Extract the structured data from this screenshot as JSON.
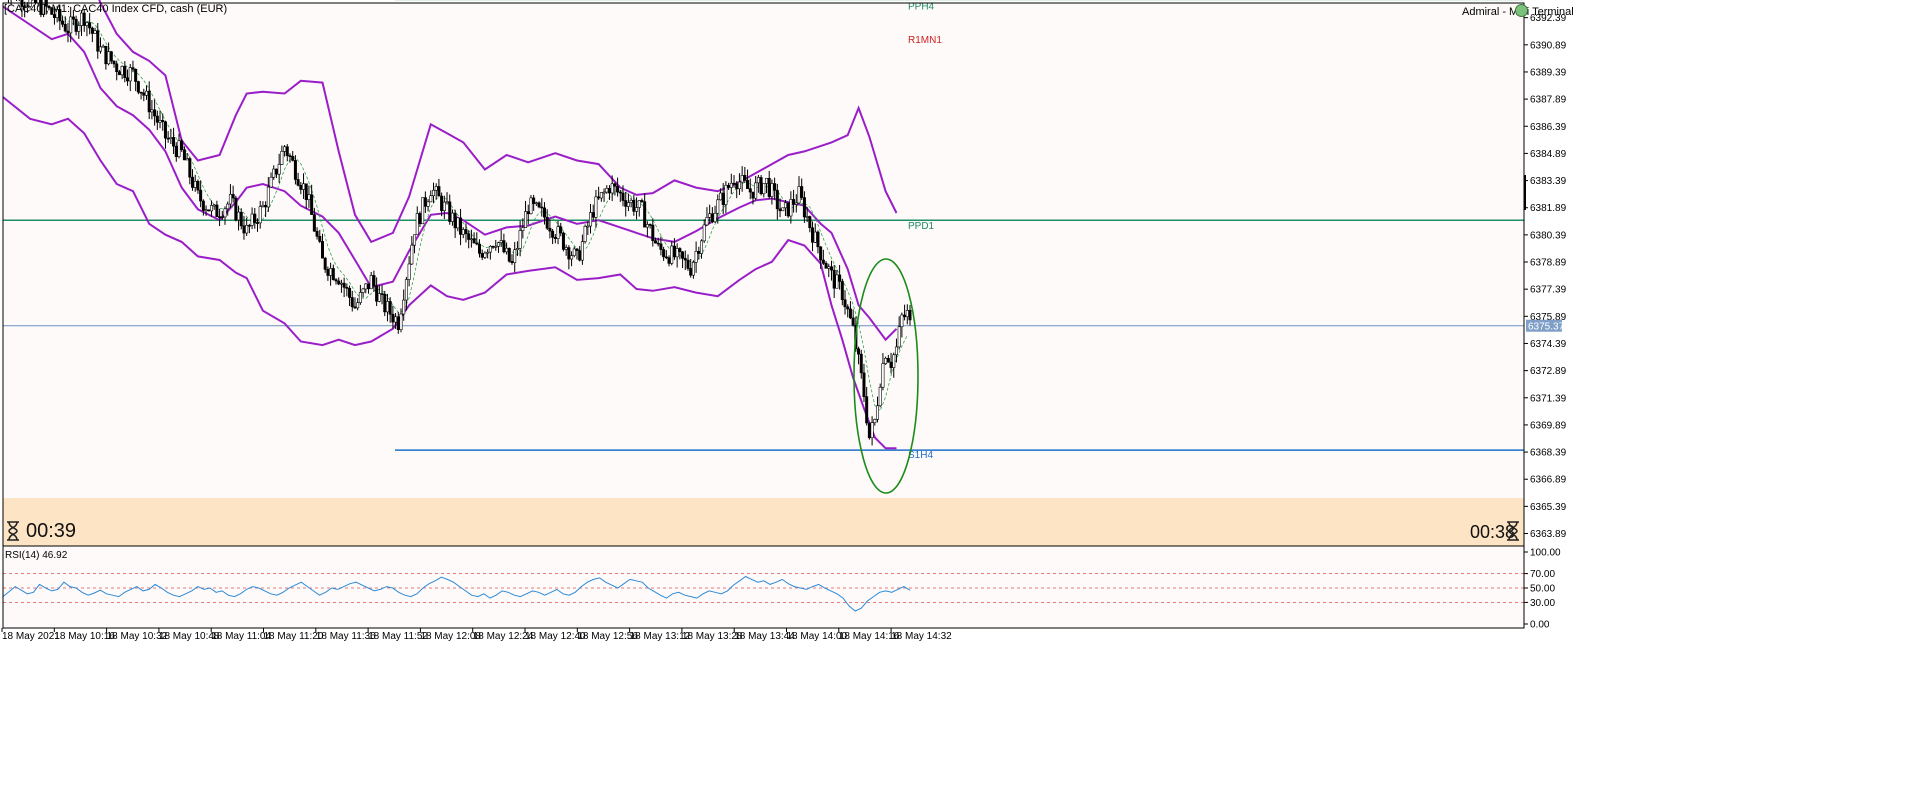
{
  "header": {
    "symbol_info": "[CAC40], M1:  CAC40 Index CFD, cash (EUR)",
    "terminal_name": "Admiral - Mini Terminal"
  },
  "timers": {
    "left": "00:39",
    "right": "00:38"
  },
  "colors": {
    "background": "#fffafa",
    "bands": "#9a1ec8",
    "candle_up": "#ffffff",
    "candle_down": "#000000",
    "pivot_line": "#1e8c64",
    "support_line": "#1e6fc8",
    "current_price_line": "#6a8fc0",
    "ellipse": "#1a8c1a",
    "rsi_line": "#2a8ad8",
    "timer_panel": "#fde4c4"
  },
  "chart_data": [
    {
      "type": "candlestick",
      "title": "[CAC40], M1:  CAC40 Index CFD, cash (EUR)",
      "price_ticks": [
        "6392.39",
        "6390.89",
        "6389.39",
        "6387.89",
        "6386.39",
        "6384.89",
        "6383.39",
        "6381.89",
        "6380.39",
        "6378.89",
        "6377.39",
        "6375.89",
        "6374.39",
        "6372.89",
        "6371.39",
        "6369.89",
        "6368.39",
        "6366.89",
        "6365.39",
        "6363.89"
      ],
      "ylim": [
        6363.2,
        6393.2
      ],
      "current_price": {
        "label": "6375.37",
        "value": 6375.37
      },
      "time_labels": [
        "18 May 2021",
        "18 May 10:16",
        "18 May 10:32",
        "18 May 10:48",
        "18 May 11:04",
        "18 May 11:20",
        "18 May 11:36",
        "18 May 11:52",
        "18 May 12:08",
        "18 May 12:24",
        "18 May 12:40",
        "18 May 12:56",
        "18 May 13:12",
        "18 May 13:28",
        "18 May 13:44",
        "18 May 14:00",
        "18 May 14:16",
        "18 May 14:32"
      ],
      "levels": [
        {
          "label": "PPH4",
          "value": 6393.4,
          "color": "#1e8c64"
        },
        {
          "label": "R1MN1",
          "value": 6391.5,
          "color": "#d02020",
          "line": false
        },
        {
          "label": "PPD1",
          "value": 6381.2,
          "color": "#1e8c64"
        },
        {
          "label": "S1H4",
          "value": 6368.5,
          "color": "#1e6fc8"
        }
      ],
      "close_path": [
        [
          0,
          6394.2
        ],
        [
          8,
          6393.4
        ],
        [
          16,
          6392.9
        ],
        [
          24,
          6391.8
        ],
        [
          30,
          6392.5
        ],
        [
          36,
          6390.6
        ],
        [
          42,
          6389.7
        ],
        [
          48,
          6389.3
        ],
        [
          54,
          6387.6
        ],
        [
          60,
          6385.8
        ],
        [
          66,
          6384.9
        ],
        [
          72,
          6382.5
        ],
        [
          78,
          6381.6
        ],
        [
          84,
          6382.2
        ],
        [
          90,
          6380.6
        ],
        [
          96,
          6381.9
        ],
        [
          104,
          6385.3
        ],
        [
          112,
          6382.7
        ],
        [
          118,
          6378.9
        ],
        [
          124,
          6378.1
        ],
        [
          130,
          6376.4
        ],
        [
          136,
          6377.9
        ],
        [
          140,
          6376.6
        ],
        [
          146,
          6375.6
        ],
        [
          152,
          6380.8
        ],
        [
          158,
          6383.0
        ],
        [
          164,
          6381.7
        ],
        [
          170,
          6380.4
        ],
        [
          176,
          6379.4
        ],
        [
          182,
          6380.2
        ],
        [
          188,
          6378.7
        ],
        [
          194,
          6382.0
        ],
        [
          200,
          6381.4
        ],
        [
          206,
          6380.2
        ],
        [
          212,
          6379.0
        ],
        [
          218,
          6381.8
        ],
        [
          224,
          6383.1
        ],
        [
          230,
          6382.4
        ],
        [
          236,
          6381.7
        ],
        [
          242,
          6379.6
        ],
        [
          248,
          6379.2
        ],
        [
          254,
          6378.6
        ],
        [
          260,
          6381.2
        ],
        [
          266,
          6382.5
        ],
        [
          270,
          6383.6
        ],
        [
          276,
          6382.8
        ],
        [
          282,
          6383.3
        ],
        [
          288,
          6381.5
        ],
        [
          294,
          6382.6
        ],
        [
          300,
          6380.1
        ],
        [
          306,
          6378.1
        ],
        [
          310,
          6377.2
        ],
        [
          314,
          6375.1
        ],
        [
          318,
          6371.6
        ],
        [
          320,
          6369.2
        ],
        [
          322,
          6370.1
        ],
        [
          324,
          6372.5
        ],
        [
          326,
          6374.0
        ],
        [
          328,
          6373.4
        ],
        [
          330,
          6374.1
        ],
        [
          332,
          6375.8
        ],
        [
          334,
          6376.0
        ],
        [
          335,
          6375.4
        ]
      ],
      "upper_band_path": [
        [
          0,
          6399.0
        ],
        [
          10,
          6397.5
        ],
        [
          18,
          6396.0
        ],
        [
          24,
          6396.5
        ],
        [
          30,
          6395.5
        ],
        [
          36,
          6393.2
        ],
        [
          42,
          6391.5
        ],
        [
          48,
          6390.5
        ],
        [
          54,
          6390.0
        ],
        [
          60,
          6389.2
        ],
        [
          66,
          6385.6
        ],
        [
          72,
          6384.5
        ],
        [
          80,
          6384.8
        ],
        [
          86,
          6387.0
        ],
        [
          90,
          6388.2
        ],
        [
          96,
          6388.3
        ],
        [
          104,
          6388.2
        ],
        [
          110,
          6388.9
        ],
        [
          118,
          6388.8
        ],
        [
          124,
          6385.0
        ],
        [
          130,
          6381.5
        ],
        [
          136,
          6380.0
        ],
        [
          144,
          6380.5
        ],
        [
          150,
          6382.5
        ],
        [
          158,
          6386.5
        ],
        [
          164,
          6386.0
        ],
        [
          170,
          6385.5
        ],
        [
          178,
          6384.0
        ],
        [
          186,
          6384.8
        ],
        [
          194,
          6384.4
        ],
        [
          204,
          6384.9
        ],
        [
          212,
          6384.5
        ],
        [
          220,
          6384.3
        ],
        [
          228,
          6383.0
        ],
        [
          234,
          6382.6
        ],
        [
          240,
          6382.7
        ],
        [
          248,
          6383.4
        ],
        [
          256,
          6383.0
        ],
        [
          264,
          6382.8
        ],
        [
          272,
          6383.3
        ],
        [
          278,
          6383.8
        ],
        [
          284,
          6384.3
        ],
        [
          290,
          6384.8
        ],
        [
          296,
          6385.0
        ],
        [
          306,
          6385.5
        ],
        [
          312,
          6385.9
        ],
        [
          316,
          6387.4
        ],
        [
          320,
          6385.8
        ],
        [
          326,
          6382.8
        ],
        [
          330,
          6381.6
        ]
      ],
      "middle_band_path": [
        [
          0,
          6393.0
        ],
        [
          10,
          6392.0
        ],
        [
          18,
          6391.2
        ],
        [
          24,
          6391.5
        ],
        [
          30,
          6390.5
        ],
        [
          36,
          6388.5
        ],
        [
          42,
          6387.5
        ],
        [
          48,
          6387.0
        ],
        [
          54,
          6386.2
        ],
        [
          60,
          6385.0
        ],
        [
          66,
          6383.0
        ],
        [
          72,
          6381.8
        ],
        [
          80,
          6381.2
        ],
        [
          86,
          6382.2
        ],
        [
          90,
          6383.0
        ],
        [
          96,
          6383.2
        ],
        [
          104,
          6382.8
        ],
        [
          110,
          6382.0
        ],
        [
          118,
          6381.4
        ],
        [
          124,
          6380.5
        ],
        [
          130,
          6379.0
        ],
        [
          136,
          6377.5
        ],
        [
          144,
          6377.8
        ],
        [
          150,
          6379.5
        ],
        [
          158,
          6381.5
        ],
        [
          164,
          6381.6
        ],
        [
          170,
          6381.2
        ],
        [
          178,
          6380.4
        ],
        [
          186,
          6380.8
        ],
        [
          194,
          6380.9
        ],
        [
          204,
          6381.4
        ],
        [
          212,
          6381.0
        ],
        [
          220,
          6381.2
        ],
        [
          228,
          6380.8
        ],
        [
          234,
          6380.5
        ],
        [
          240,
          6380.2
        ],
        [
          248,
          6380.0
        ],
        [
          256,
          6380.6
        ],
        [
          264,
          6381.3
        ],
        [
          272,
          6381.9
        ],
        [
          278,
          6382.3
        ],
        [
          284,
          6382.4
        ],
        [
          290,
          6382.2
        ],
        [
          296,
          6382.0
        ],
        [
          302,
          6381.0
        ],
        [
          306,
          6380.5
        ],
        [
          312,
          6378.5
        ],
        [
          316,
          6376.5
        ],
        [
          320,
          6375.8
        ],
        [
          326,
          6374.6
        ],
        [
          330,
          6375.2
        ]
      ],
      "lower_band_path": [
        [
          0,
          6388.0
        ],
        [
          10,
          6386.8
        ],
        [
          18,
          6386.5
        ],
        [
          24,
          6386.8
        ],
        [
          30,
          6386.0
        ],
        [
          36,
          6384.5
        ],
        [
          42,
          6383.2
        ],
        [
          48,
          6382.8
        ],
        [
          54,
          6381.0
        ],
        [
          60,
          6380.4
        ],
        [
          66,
          6380.0
        ],
        [
          72,
          6379.2
        ],
        [
          80,
          6379.0
        ],
        [
          86,
          6378.3
        ],
        [
          90,
          6378.0
        ],
        [
          96,
          6376.2
        ],
        [
          104,
          6375.5
        ],
        [
          110,
          6374.5
        ],
        [
          118,
          6374.3
        ],
        [
          124,
          6374.6
        ],
        [
          130,
          6374.3
        ],
        [
          136,
          6374.5
        ],
        [
          144,
          6375.2
        ],
        [
          150,
          6376.5
        ],
        [
          158,
          6377.6
        ],
        [
          164,
          6377.0
        ],
        [
          170,
          6376.8
        ],
        [
          178,
          6377.2
        ],
        [
          186,
          6378.2
        ],
        [
          194,
          6378.4
        ],
        [
          204,
          6378.6
        ],
        [
          212,
          6377.9
        ],
        [
          220,
          6378.0
        ],
        [
          228,
          6378.2
        ],
        [
          234,
          6377.4
        ],
        [
          240,
          6377.3
        ],
        [
          248,
          6377.5
        ],
        [
          256,
          6377.2
        ],
        [
          264,
          6377.0
        ],
        [
          272,
          6377.9
        ],
        [
          278,
          6378.5
        ],
        [
          284,
          6378.9
        ],
        [
          290,
          6380.1
        ],
        [
          296,
          6379.8
        ],
        [
          302,
          6378.8
        ],
        [
          306,
          6376.5
        ],
        [
          310,
          6374.6
        ],
        [
          314,
          6372.5
        ],
        [
          318,
          6370.8
        ],
        [
          322,
          6369.2
        ],
        [
          326,
          6368.6
        ],
        [
          330,
          6368.6
        ]
      ],
      "annotation": {
        "shape": "ellipse",
        "note": "green ellipse around the dip near S1H4"
      }
    },
    {
      "type": "line",
      "title": "RSI(14) 46.92",
      "label": "RSI(14) 46.92",
      "ticks": [
        "100.00",
        "70.00",
        "50.00",
        "30.00",
        "0.00"
      ],
      "ylim": [
        0,
        100
      ],
      "reference_lines": [
        70,
        50,
        30
      ],
      "values": [
        38,
        45,
        52,
        47,
        42,
        44,
        55,
        50,
        46,
        48,
        58,
        52,
        50,
        44,
        40,
        43,
        47,
        42,
        40,
        38,
        44,
        48,
        52,
        46,
        48,
        55,
        50,
        44,
        40,
        38,
        42,
        46,
        52,
        48,
        50,
        44,
        46,
        40,
        38,
        42,
        48,
        52,
        50,
        46,
        42,
        40,
        44,
        50,
        54,
        58,
        52,
        46,
        40,
        44,
        50,
        48,
        52,
        56,
        58,
        54,
        50,
        46,
        48,
        52,
        50,
        44,
        40,
        38,
        42,
        50,
        56,
        60,
        65,
        62,
        58,
        52,
        46,
        40,
        38,
        42,
        36,
        40,
        46,
        44,
        40,
        38,
        42,
        46,
        44,
        40,
        44,
        48,
        42,
        40,
        44,
        52,
        58,
        62,
        64,
        58,
        54,
        50,
        56,
        62,
        60,
        58,
        50,
        45,
        40,
        36,
        42,
        44,
        40,
        38,
        36,
        42,
        46,
        44,
        42,
        46,
        54,
        60,
        66,
        62,
        58,
        60,
        55,
        58,
        62,
        56,
        52,
        50,
        48,
        52,
        55,
        50,
        46,
        42,
        36,
        25,
        18,
        22,
        32,
        38,
        44,
        46,
        44,
        48,
        52,
        46.9
      ]
    }
  ]
}
